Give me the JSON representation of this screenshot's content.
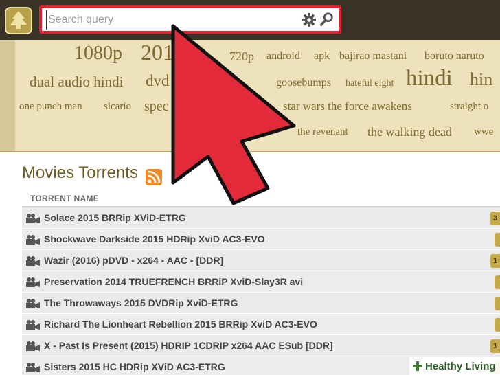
{
  "search": {
    "placeholder": "Search query"
  },
  "tags": [
    "1080p",
    "2016",
    "720p",
    "android",
    "apk",
    "bajirao mastani",
    "boruto naruto",
    "dual audio hindi",
    "dvd",
    "goosebumps",
    "hateful eight",
    "hindi",
    "hin",
    "one punch man",
    "sicario",
    "spec",
    "star wars the force awakens",
    "straight o",
    "the revenant",
    "the walking dead",
    "wwe"
  ],
  "section": {
    "title": "Movies Torrents",
    "column_header": "TORRENT NAME"
  },
  "torrents": [
    {
      "name": "Solace 2015 BRRip XViD-ETRG",
      "badge": "3"
    },
    {
      "name": "Shockwave Darkside 2015 HDRip XviD AC3-EVO",
      "badge": ""
    },
    {
      "name": "Wazir (2016) pDVD - x264 - AAC - [DDR]",
      "badge": "1"
    },
    {
      "name": "Preservation 2014 TRUEFRENCH BRRiP XviD-Slay3R avi",
      "badge": ""
    },
    {
      "name": "The Throwaways 2015 DVDRip XviD-ETRG",
      "badge": ""
    },
    {
      "name": "Richard The Lionheart Rebellion 2015 BRRip XviD AC3-EVO",
      "badge": ""
    },
    {
      "name": "X - Past Is Present (2015) HDRIP 1CDRIP x264 AAC ESub [DDR]",
      "badge": "1"
    },
    {
      "name": "Sisters 2015 HC HDRip XViD AC3-ETRG",
      "badge": ""
    }
  ],
  "watermark": {
    "text": "Healthy Living"
  },
  "colors": {
    "accent_red": "#e3202f",
    "cloud_bg": "#ede2bc",
    "tag_text": "#7d6b32",
    "topbar": "#3a3328"
  }
}
